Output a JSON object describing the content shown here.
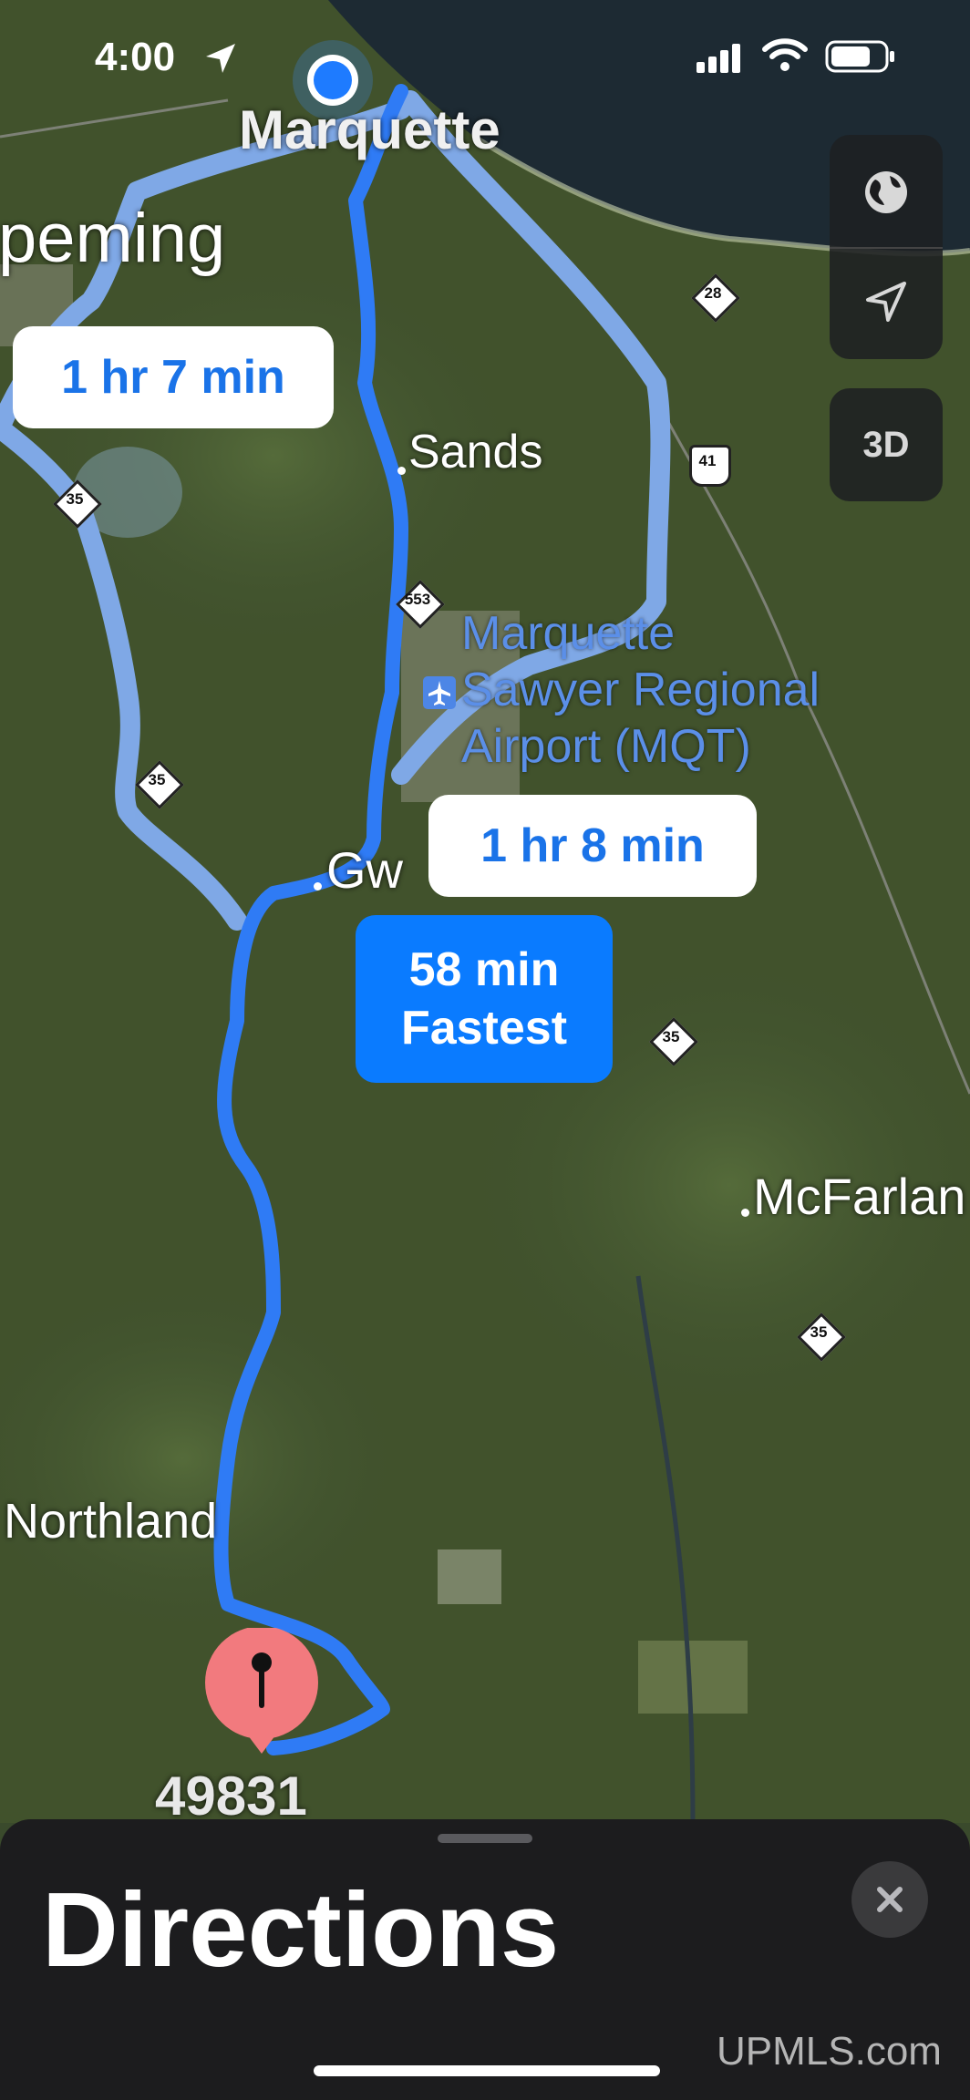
{
  "status_bar": {
    "time": "4:00"
  },
  "map": {
    "places": {
      "marquette": "Marquette",
      "ishpeming": "peming",
      "sands": "Sands",
      "gwinn": "Gw",
      "mcfarland": "McFarlan",
      "northland": "Northland",
      "destination": "49831"
    },
    "airport_name": [
      "Marquette",
      "Sawyer Regional",
      "Airport (MQT)"
    ],
    "route_shields": [
      "28",
      "41",
      "35",
      "553",
      "35",
      "35",
      "35"
    ],
    "routes": [
      {
        "time": "1 hr 7 min"
      },
      {
        "time": "1 hr 8 min"
      },
      {
        "time": "58 min",
        "tag": "Fastest"
      }
    ],
    "controls": {
      "three_d": "3D"
    },
    "colors": {
      "route_primary": "#2f7bf5",
      "route_alt": "#7fa8e6",
      "pin": "#f36b6f"
    }
  },
  "sheet": {
    "title": "Directions"
  },
  "watermark": "UPMLS.com"
}
